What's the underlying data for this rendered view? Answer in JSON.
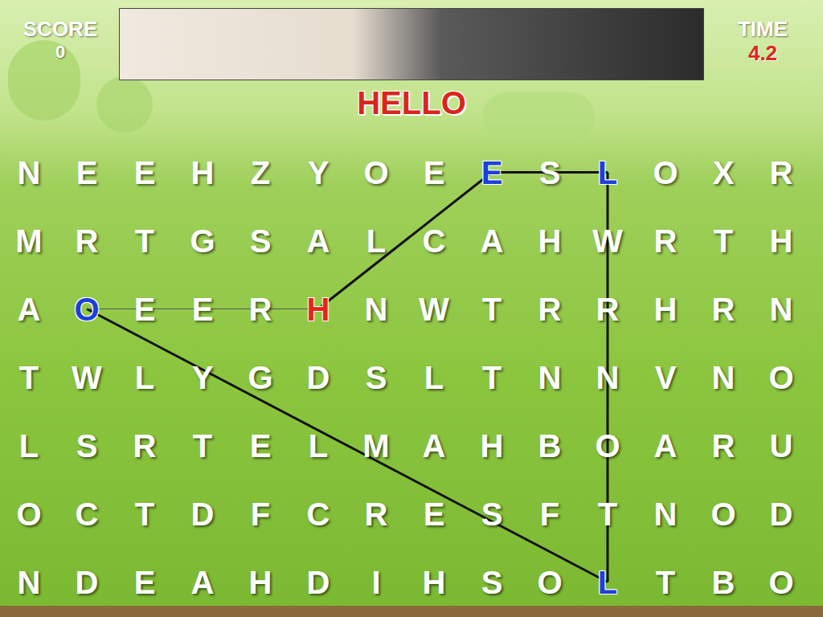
{
  "score": {
    "label": "SCORE",
    "value": "0"
  },
  "time": {
    "label": "TIME",
    "value": "4.2"
  },
  "target_word": "HELLO",
  "grid": {
    "rows": [
      [
        {
          "letter": "N",
          "kind": "plain"
        },
        {
          "letter": "E",
          "kind": "plain"
        },
        {
          "letter": "E",
          "kind": "plain"
        },
        {
          "letter": "H",
          "kind": "plain"
        },
        {
          "letter": "Z",
          "kind": "plain"
        },
        {
          "letter": "Y",
          "kind": "plain"
        },
        {
          "letter": "O",
          "kind": "plain"
        },
        {
          "letter": "E",
          "kind": "plain"
        },
        {
          "letter": "E",
          "kind": "found"
        },
        {
          "letter": "S",
          "kind": "plain"
        },
        {
          "letter": "L",
          "kind": "found"
        },
        {
          "letter": "O",
          "kind": "plain"
        },
        {
          "letter": "X",
          "kind": "plain"
        },
        {
          "letter": "R",
          "kind": "plain"
        }
      ],
      [
        {
          "letter": "M",
          "kind": "plain"
        },
        {
          "letter": "R",
          "kind": "plain"
        },
        {
          "letter": "T",
          "kind": "plain"
        },
        {
          "letter": "G",
          "kind": "plain"
        },
        {
          "letter": "S",
          "kind": "plain"
        },
        {
          "letter": "A",
          "kind": "plain"
        },
        {
          "letter": "L",
          "kind": "plain"
        },
        {
          "letter": "C",
          "kind": "plain"
        },
        {
          "letter": "A",
          "kind": "plain"
        },
        {
          "letter": "H",
          "kind": "plain"
        },
        {
          "letter": "W",
          "kind": "plain"
        },
        {
          "letter": "R",
          "kind": "plain"
        },
        {
          "letter": "T",
          "kind": "plain"
        },
        {
          "letter": "H",
          "kind": "plain"
        }
      ],
      [
        {
          "letter": "A",
          "kind": "plain"
        },
        {
          "letter": "O",
          "kind": "found"
        },
        {
          "letter": "E",
          "kind": "plain"
        },
        {
          "letter": "E",
          "kind": "plain"
        },
        {
          "letter": "R",
          "kind": "plain"
        },
        {
          "letter": "H",
          "kind": "start"
        },
        {
          "letter": "N",
          "kind": "plain"
        },
        {
          "letter": "W",
          "kind": "plain"
        },
        {
          "letter": "T",
          "kind": "plain"
        },
        {
          "letter": "R",
          "kind": "plain"
        },
        {
          "letter": "R",
          "kind": "plain"
        },
        {
          "letter": "H",
          "kind": "plain"
        },
        {
          "letter": "R",
          "kind": "plain"
        },
        {
          "letter": "N",
          "kind": "plain"
        }
      ],
      [
        {
          "letter": "T",
          "kind": "plain"
        },
        {
          "letter": "W",
          "kind": "plain"
        },
        {
          "letter": "L",
          "kind": "plain"
        },
        {
          "letter": "Y",
          "kind": "plain"
        },
        {
          "letter": "G",
          "kind": "plain"
        },
        {
          "letter": "D",
          "kind": "plain"
        },
        {
          "letter": "S",
          "kind": "plain"
        },
        {
          "letter": "L",
          "kind": "plain"
        },
        {
          "letter": "T",
          "kind": "plain"
        },
        {
          "letter": "N",
          "kind": "plain"
        },
        {
          "letter": "N",
          "kind": "plain"
        },
        {
          "letter": "V",
          "kind": "plain"
        },
        {
          "letter": "N",
          "kind": "plain"
        },
        {
          "letter": "O",
          "kind": "plain"
        }
      ],
      [
        {
          "letter": "L",
          "kind": "plain"
        },
        {
          "letter": "S",
          "kind": "plain"
        },
        {
          "letter": "R",
          "kind": "plain"
        },
        {
          "letter": "T",
          "kind": "plain"
        },
        {
          "letter": "E",
          "kind": "plain"
        },
        {
          "letter": "L",
          "kind": "plain"
        },
        {
          "letter": "M",
          "kind": "plain"
        },
        {
          "letter": "A",
          "kind": "plain"
        },
        {
          "letter": "H",
          "kind": "plain"
        },
        {
          "letter": "B",
          "kind": "plain"
        },
        {
          "letter": "O",
          "kind": "plain"
        },
        {
          "letter": "A",
          "kind": "plain"
        },
        {
          "letter": "R",
          "kind": "plain"
        },
        {
          "letter": "U",
          "kind": "plain"
        }
      ],
      [
        {
          "letter": "O",
          "kind": "plain"
        },
        {
          "letter": "C",
          "kind": "plain"
        },
        {
          "letter": "T",
          "kind": "plain"
        },
        {
          "letter": "D",
          "kind": "plain"
        },
        {
          "letter": "F",
          "kind": "plain"
        },
        {
          "letter": "C",
          "kind": "plain"
        },
        {
          "letter": "R",
          "kind": "plain"
        },
        {
          "letter": "E",
          "kind": "plain"
        },
        {
          "letter": "S",
          "kind": "plain"
        },
        {
          "letter": "F",
          "kind": "plain"
        },
        {
          "letter": "T",
          "kind": "plain"
        },
        {
          "letter": "N",
          "kind": "plain"
        },
        {
          "letter": "O",
          "kind": "plain"
        },
        {
          "letter": "D",
          "kind": "plain"
        }
      ],
      [
        {
          "letter": "N",
          "kind": "plain"
        },
        {
          "letter": "D",
          "kind": "plain"
        },
        {
          "letter": "E",
          "kind": "plain"
        },
        {
          "letter": "A",
          "kind": "plain"
        },
        {
          "letter": "H",
          "kind": "plain"
        },
        {
          "letter": "D",
          "kind": "plain"
        },
        {
          "letter": "I",
          "kind": "plain"
        },
        {
          "letter": "H",
          "kind": "plain"
        },
        {
          "letter": "S",
          "kind": "plain"
        },
        {
          "letter": "O",
          "kind": "plain"
        },
        {
          "letter": "L",
          "kind": "found"
        },
        {
          "letter": "T",
          "kind": "plain"
        },
        {
          "letter": "B",
          "kind": "plain"
        },
        {
          "letter": "O",
          "kind": "plain"
        }
      ]
    ]
  },
  "lines": [
    {
      "from": [
        2,
        5
      ],
      "to": [
        0,
        8
      ],
      "thin": false
    },
    {
      "from": [
        0,
        8
      ],
      "to": [
        0,
        10
      ],
      "thin": false
    },
    {
      "from": [
        0,
        10
      ],
      "to": [
        6,
        10
      ],
      "thin": false
    },
    {
      "from": [
        6,
        10
      ],
      "to": [
        2,
        1
      ],
      "thin": false
    },
    {
      "from": [
        2,
        1
      ],
      "to": [
        2,
        5
      ],
      "thin": true
    }
  ]
}
